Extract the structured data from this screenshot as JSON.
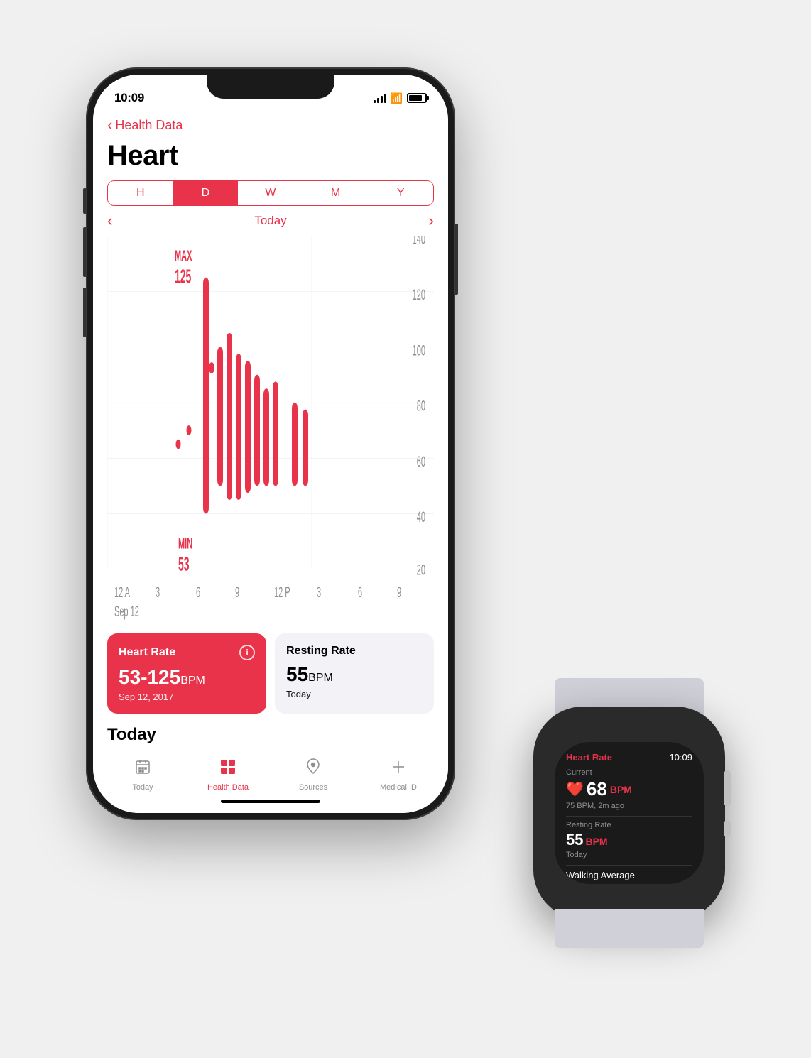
{
  "page": {
    "background_color": "#f0f0f0"
  },
  "iphone": {
    "status_bar": {
      "time": "10:09"
    },
    "nav": {
      "back_label": "Health Data"
    },
    "page_title": "Heart",
    "period_tabs": {
      "options": [
        "H",
        "D",
        "W",
        "M",
        "Y"
      ],
      "active": "D"
    },
    "date_nav": {
      "label": "Today"
    },
    "chart": {
      "y_max": 140,
      "y_labels": [
        140,
        120,
        100,
        80,
        60,
        40,
        20
      ],
      "x_labels": [
        "12 A",
        "3",
        "6",
        "9",
        "12 P",
        "3",
        "6",
        "9"
      ],
      "x_sublabel": "Sep 12",
      "max_label": "MAX",
      "max_value": "125",
      "min_label": "MIN",
      "min_value": "53"
    },
    "heart_rate_card": {
      "title": "Heart Rate",
      "value": "53-125",
      "unit": "BPM",
      "subtitle": "Sep 12, 2017"
    },
    "resting_rate_card": {
      "title": "Resting Rate",
      "value": "55",
      "unit": "BPM",
      "subtitle": "Today"
    },
    "today_section": {
      "title": "Today"
    },
    "tab_bar": {
      "tabs": [
        {
          "label": "Today",
          "icon": "📅",
          "active": false
        },
        {
          "label": "Health Data",
          "icon": "▦",
          "active": true
        },
        {
          "label": "Sources",
          "icon": "♥",
          "active": false
        },
        {
          "label": "Medical ID",
          "icon": "✳",
          "active": false
        }
      ]
    }
  },
  "watch": {
    "app_title": "Heart Rate",
    "time": "10:09",
    "current_section": {
      "label": "Current",
      "bpm": "68",
      "unit": "BPM",
      "sub": "75 BPM, 2m ago"
    },
    "resting_section": {
      "label": "Resting Rate",
      "bpm": "55",
      "unit": "BPM",
      "sub": "Today"
    },
    "walking_section": {
      "label": "Walking Average"
    }
  }
}
